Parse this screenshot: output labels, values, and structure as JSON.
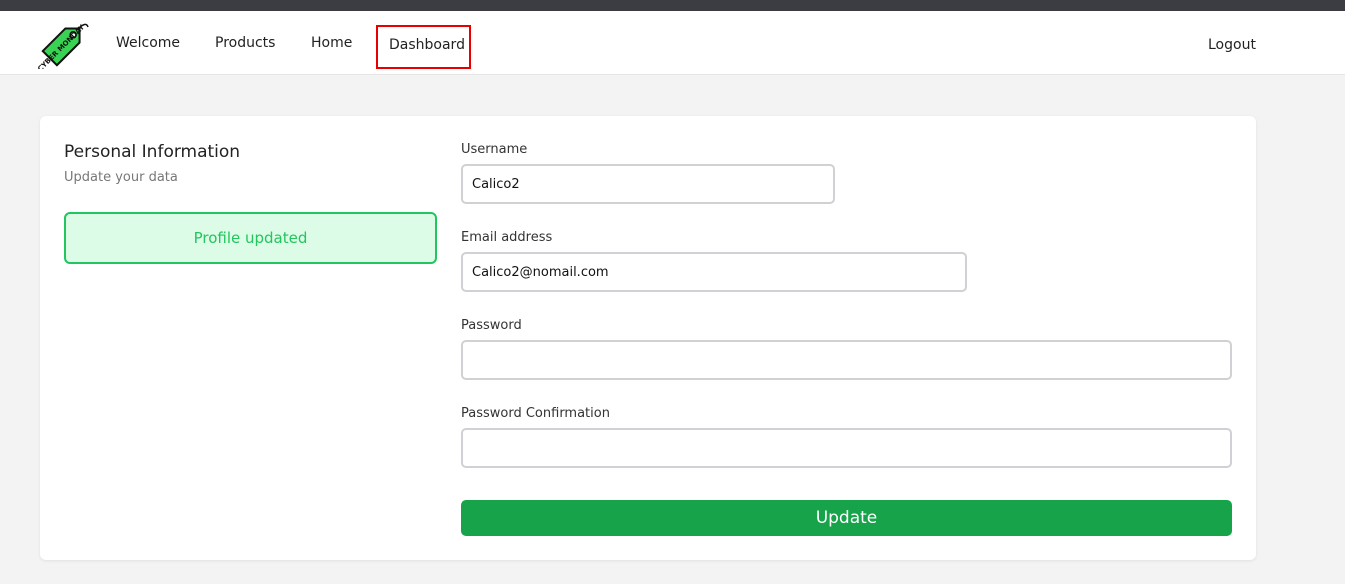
{
  "nav": {
    "logo_text": "CYBER MONDAY",
    "links": [
      "Welcome",
      "Products",
      "Home",
      "Dashboard"
    ],
    "logout": "Logout",
    "highlighted": "Dashboard"
  },
  "panel": {
    "title": "Personal Information",
    "subtitle": "Update your data",
    "alert": "Profile updated"
  },
  "form": {
    "username_label": "Username",
    "username_value": "Calico2",
    "email_label": "Email address",
    "email_value": "Calico2@nomail.com",
    "password_label": "Password",
    "password_value": "",
    "password_confirm_label": "Password Confirmation",
    "password_confirm_value": "",
    "submit_label": "Update"
  },
  "colors": {
    "accent_green": "#16a34a",
    "alert_bg": "#dcfce7",
    "alert_border": "#22c55e",
    "highlight_box": "#e60000",
    "logo_green": "#39d353"
  }
}
